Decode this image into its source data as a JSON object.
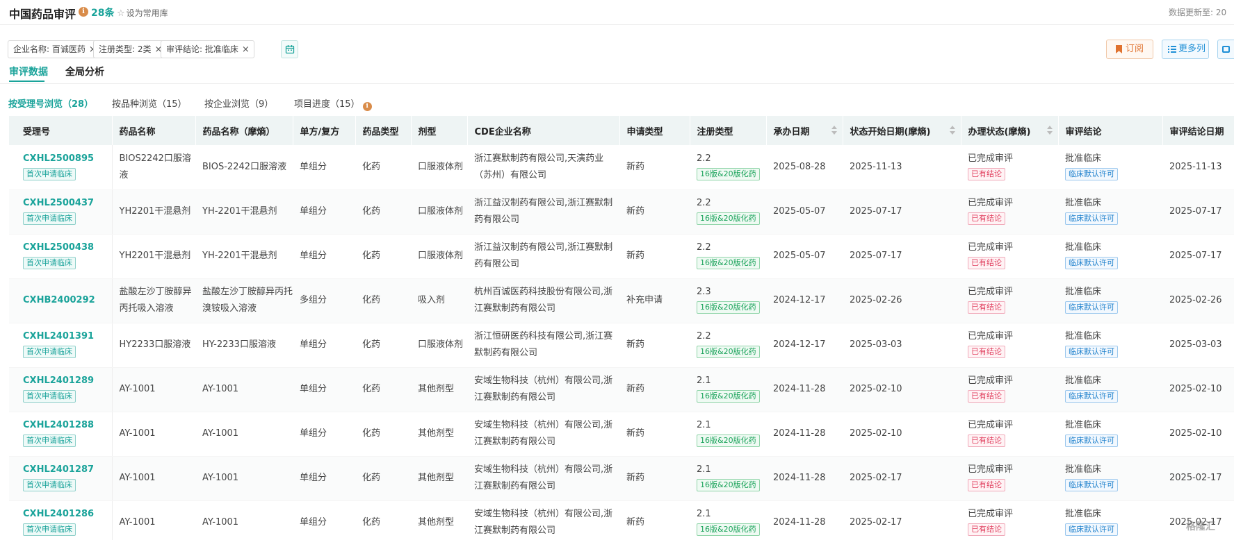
{
  "header": {
    "title": "中国药品审评",
    "info_icon": "i",
    "count": "28条",
    "favorite": "设为常用库",
    "update_label": "数据更新至: 20"
  },
  "filters": [
    {
      "label": "企业名称: 百诚医药",
      "close": "×"
    },
    {
      "label": "注册类型: 2类",
      "close": "×"
    },
    {
      "label": "审评结论: 批准临床",
      "close": "×"
    }
  ],
  "actions": {
    "subscribe": "订阅",
    "more": "更多列"
  },
  "tabs": [
    {
      "label": "审评数据",
      "active": true
    },
    {
      "label": "全局分析",
      "active": false
    }
  ],
  "subtabs": [
    {
      "label": "按受理号浏览（28）",
      "active": true
    },
    {
      "label": "按品种浏览（15）",
      "active": false
    },
    {
      "label": "按企业浏览（9）",
      "active": false
    },
    {
      "label": "项目进度（15）",
      "active": false,
      "info": "i"
    }
  ],
  "table": {
    "columns": [
      "受理号",
      "药品名称",
      "药品名称（摩熵）",
      "单方/复方",
      "药品类型",
      "剂型",
      "CDE企业名称",
      "申请类型",
      "注册类型",
      "承办日期",
      "状态开始日期(摩熵)",
      "办理状态(摩熵)",
      "审评结论",
      "审评结论日期"
    ],
    "rows": [
      {
        "id": "CXHL2500895",
        "id_tag": "首次申请临床",
        "name": "BIOS2242口服溶液",
        "name_ms": "BIOS-2242口服溶液",
        "compound": "单组分",
        "drug_type": "化药",
        "form": "口服液体剂",
        "company": "浙江赛默制药有限公司,天演药业（苏州）有限公司",
        "app_type": "新药",
        "reg_type": "2.2",
        "reg_tag": "16版&20版化药",
        "accept_date": "2025-08-28",
        "status_date": "2025-11-13",
        "status": "已完成审评",
        "status_tag": "已有结论",
        "conclusion": "批准临床",
        "conclusion_tag": "临床默认许可",
        "conclusion_date": "2025-11-13"
      },
      {
        "id": "CXHL2500437",
        "id_tag": "首次申请临床",
        "name": "YH2201干混悬剂",
        "name_ms": "YH-2201干混悬剂",
        "compound": "单组分",
        "drug_type": "化药",
        "form": "口服液体剂",
        "company": "浙江益汉制药有限公司,浙江赛默制药有限公司",
        "app_type": "新药",
        "reg_type": "2.2",
        "reg_tag": "16版&20版化药",
        "accept_date": "2025-05-07",
        "status_date": "2025-07-17",
        "status": "已完成审评",
        "status_tag": "已有结论",
        "conclusion": "批准临床",
        "conclusion_tag": "临床默认许可",
        "conclusion_date": "2025-07-17"
      },
      {
        "id": "CXHL2500438",
        "id_tag": "首次申请临床",
        "name": "YH2201干混悬剂",
        "name_ms": "YH-2201干混悬剂",
        "compound": "单组分",
        "drug_type": "化药",
        "form": "口服液体剂",
        "company": "浙江益汉制药有限公司,浙江赛默制药有限公司",
        "app_type": "新药",
        "reg_type": "2.2",
        "reg_tag": "16版&20版化药",
        "accept_date": "2025-05-07",
        "status_date": "2025-07-17",
        "status": "已完成审评",
        "status_tag": "已有结论",
        "conclusion": "批准临床",
        "conclusion_tag": "临床默认许可",
        "conclusion_date": "2025-07-17"
      },
      {
        "id": "CXHB2400292",
        "id_tag": "",
        "name": "盐酸左沙丁胺醇异丙托吸入溶液",
        "name_ms": "盐酸左沙丁胺醇异丙托溴铵吸入溶液",
        "compound": "多组分",
        "drug_type": "化药",
        "form": "吸入剂",
        "company": "杭州百诚医药科技股份有限公司,浙江赛默制药有限公司",
        "app_type": "补充申请",
        "reg_type": "2.3",
        "reg_tag": "16版&20版化药",
        "accept_date": "2024-12-17",
        "status_date": "2025-02-26",
        "status": "已完成审评",
        "status_tag": "已有结论",
        "conclusion": "批准临床",
        "conclusion_tag": "临床默认许可",
        "conclusion_date": "2025-02-26"
      },
      {
        "id": "CXHL2401391",
        "id_tag": "首次申请临床",
        "name": "HY2233口服溶液",
        "name_ms": "HY-2233口服溶液",
        "compound": "单组分",
        "drug_type": "化药",
        "form": "口服液体剂",
        "company": "浙江恒研医药科技有限公司,浙江赛默制药有限公司",
        "app_type": "新药",
        "reg_type": "2.2",
        "reg_tag": "16版&20版化药",
        "accept_date": "2024-12-17",
        "status_date": "2025-03-03",
        "status": "已完成审评",
        "status_tag": "已有结论",
        "conclusion": "批准临床",
        "conclusion_tag": "临床默认许可",
        "conclusion_date": "2025-03-03"
      },
      {
        "id": "CXHL2401289",
        "id_tag": "首次申请临床",
        "name": "AY-1001",
        "name_ms": "AY-1001",
        "compound": "单组分",
        "drug_type": "化药",
        "form": "其他剂型",
        "company": "安域生物科技（杭州）有限公司,浙江赛默制药有限公司",
        "app_type": "新药",
        "reg_type": "2.1",
        "reg_tag": "16版&20版化药",
        "accept_date": "2024-11-28",
        "status_date": "2025-02-10",
        "status": "已完成审评",
        "status_tag": "已有结论",
        "conclusion": "批准临床",
        "conclusion_tag": "临床默认许可",
        "conclusion_date": "2025-02-10"
      },
      {
        "id": "CXHL2401288",
        "id_tag": "首次申请临床",
        "name": "AY-1001",
        "name_ms": "AY-1001",
        "compound": "单组分",
        "drug_type": "化药",
        "form": "其他剂型",
        "company": "安域生物科技（杭州）有限公司,浙江赛默制药有限公司",
        "app_type": "新药",
        "reg_type": "2.1",
        "reg_tag": "16版&20版化药",
        "accept_date": "2024-11-28",
        "status_date": "2025-02-10",
        "status": "已完成审评",
        "status_tag": "已有结论",
        "conclusion": "批准临床",
        "conclusion_tag": "临床默认许可",
        "conclusion_date": "2025-02-10"
      },
      {
        "id": "CXHL2401287",
        "id_tag": "首次申请临床",
        "name": "AY-1001",
        "name_ms": "AY-1001",
        "compound": "单组分",
        "drug_type": "化药",
        "form": "其他剂型",
        "company": "安域生物科技（杭州）有限公司,浙江赛默制药有限公司",
        "app_type": "新药",
        "reg_type": "2.1",
        "reg_tag": "16版&20版化药",
        "accept_date": "2024-11-28",
        "status_date": "2025-02-17",
        "status": "已完成审评",
        "status_tag": "已有结论",
        "conclusion": "批准临床",
        "conclusion_tag": "临床默认许可",
        "conclusion_date": "2025-02-17"
      },
      {
        "id": "CXHL2401286",
        "id_tag": "首次申请临床",
        "name": "AY-1001",
        "name_ms": "AY-1001",
        "compound": "单组分",
        "drug_type": "化药",
        "form": "其他剂型",
        "company": "安域生物科技（杭州）有限公司,浙江赛默制药有限公司",
        "app_type": "新药",
        "reg_type": "2.1",
        "reg_tag": "16版&20版化药",
        "accept_date": "2024-11-28",
        "status_date": "2025-02-17",
        "status": "已完成审评",
        "status_tag": "已有结论",
        "conclusion": "批准临床",
        "conclusion_tag": "临床默认许可",
        "conclusion_date": "2025-02-17"
      }
    ]
  },
  "watermark": "格隆汇",
  "colors": {
    "accent": "#1aa39a",
    "warning": "#e0722f",
    "link_blue": "#1e8fd6",
    "tag_red": "#e0405f"
  }
}
